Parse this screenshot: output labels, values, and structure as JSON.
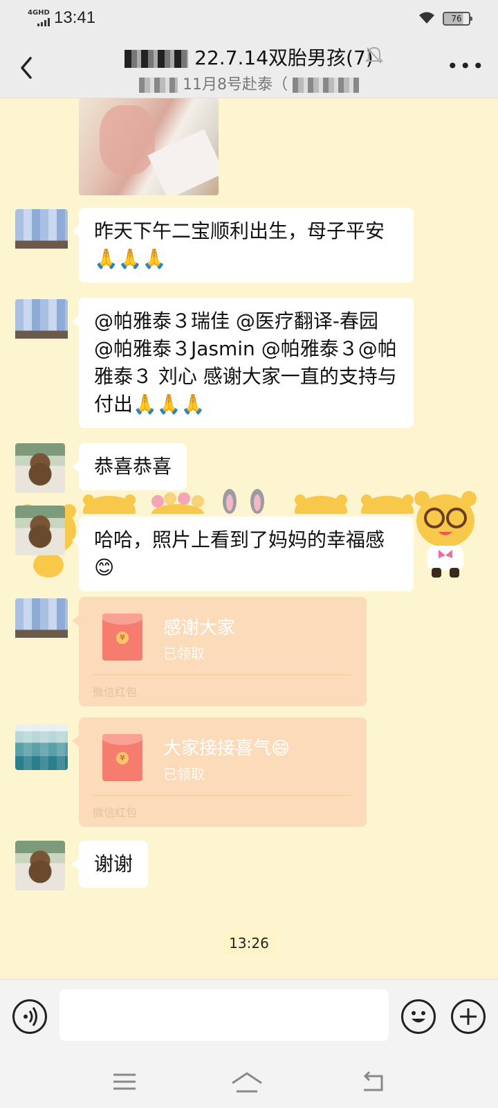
{
  "status_bar": {
    "network": "4GHD",
    "time": "13:41",
    "battery": "76"
  },
  "header": {
    "title_visible": "22.7.14双胎男孩(7)",
    "subtitle_visible": "11月8号赴泰（"
  },
  "messages": [
    {
      "type": "image"
    },
    {
      "type": "text",
      "text": "昨天下午二宝顺利出生，母子平安🙏🙏🙏"
    },
    {
      "type": "text",
      "text": "@帕雅泰３瑞佳 @医疗翻译-春园 @帕雅泰３Jasmin @帕雅泰３@帕雅泰３ 刘心  感谢大家一直的支持与付出🙏🙏🙏"
    },
    {
      "type": "text",
      "text": "恭喜恭喜"
    },
    {
      "type": "text",
      "text": "哈哈，照片上看到了妈妈的幸福感😊"
    },
    {
      "type": "red_packet",
      "title": "感谢大家",
      "status": "已领取",
      "footer": "微信红包"
    },
    {
      "type": "red_packet",
      "title": "大家接接喜气😄",
      "status": "已领取",
      "footer": "微信红包"
    },
    {
      "type": "text",
      "text": "谢谢"
    }
  ],
  "timestamp": "13:26",
  "input": {
    "value": "",
    "placeholder": ""
  },
  "icons": {
    "back": "chevron-left-icon",
    "mute": "bell-off-icon",
    "more": "more-horizontal-icon",
    "voice": "voice-icon",
    "emoji": "emoji-icon",
    "plus": "plus-icon",
    "nav_menu": "menu-icon",
    "nav_home": "home-icon",
    "nav_back": "back-icon"
  },
  "colors": {
    "chat_background": "#fdf5cf",
    "bubble": "#ffffff",
    "red_packet": "#fbdbb9",
    "envelope": "#f57c6e"
  }
}
